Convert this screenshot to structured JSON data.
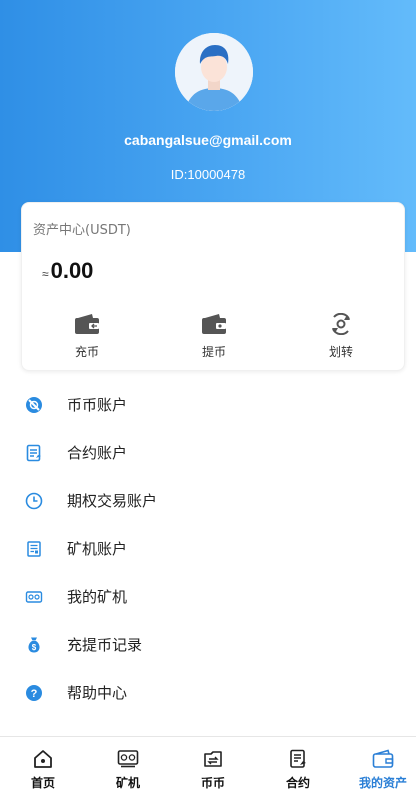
{
  "profile": {
    "email": "cabangalsue@gmail.com",
    "id_text": "ID:10000478"
  },
  "assets": {
    "title": "资产中心(USDT)",
    "approx_symbol": "≈",
    "balance": "0.00",
    "actions": [
      {
        "label": "充币",
        "icon": "wallet-deposit-icon"
      },
      {
        "label": "提币",
        "icon": "wallet-withdraw-icon"
      },
      {
        "label": "划转",
        "icon": "transfer-icon"
      }
    ]
  },
  "menu": [
    {
      "label": "币币账户",
      "icon": "coin-account-icon"
    },
    {
      "label": "合约账户",
      "icon": "contract-account-icon"
    },
    {
      "label": "期权交易账户",
      "icon": "clock-icon"
    },
    {
      "label": "矿机账户",
      "icon": "miner-account-icon"
    },
    {
      "label": "我的矿机",
      "icon": "my-miner-icon"
    },
    {
      "label": "充提币记录",
      "icon": "money-bag-icon"
    },
    {
      "label": "帮助中心",
      "icon": "help-icon"
    }
  ],
  "tabs": [
    {
      "label": "首页",
      "icon": "home-icon"
    },
    {
      "label": "矿机",
      "icon": "miner-icon"
    },
    {
      "label": "币币",
      "icon": "exchange-icon"
    },
    {
      "label": "合约",
      "icon": "contract-icon"
    },
    {
      "label": "我的资产",
      "icon": "wallet-icon",
      "active": true
    }
  ],
  "colors": {
    "accent": "#2a7fd6",
    "hero_start": "#2f8fe6",
    "hero_end": "#63bbfb"
  }
}
